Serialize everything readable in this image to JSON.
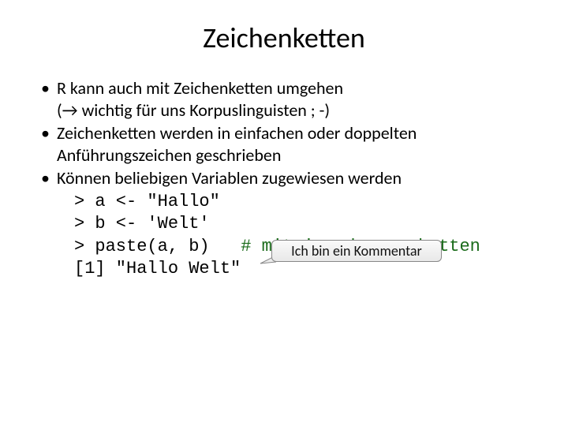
{
  "title": "Zeichenketten",
  "bullets": [
    {
      "line1": "R kann auch mit Zeichenketten umgehen",
      "line2_prefix": "(",
      "line2_arrow": "→",
      "line2_rest": " wichtig für uns Korpuslinguisten ; -)"
    },
    {
      "line1": "Zeichenketten werden in einfachen oder doppelten",
      "line2": "Anführungszeichen geschrieben"
    },
    {
      "line1": "Können beliebigen Variablen zugewiesen werden"
    }
  ],
  "code": {
    "l1": "> a <- \"Hallo\"",
    "l2": "> b <- 'Welt'",
    "l3a": "> paste(a, b)   ",
    "l3b": "# miteinander verketten",
    "l4": "[1] \"Hallo Welt\""
  },
  "callout": "Ich bin ein Kommentar"
}
